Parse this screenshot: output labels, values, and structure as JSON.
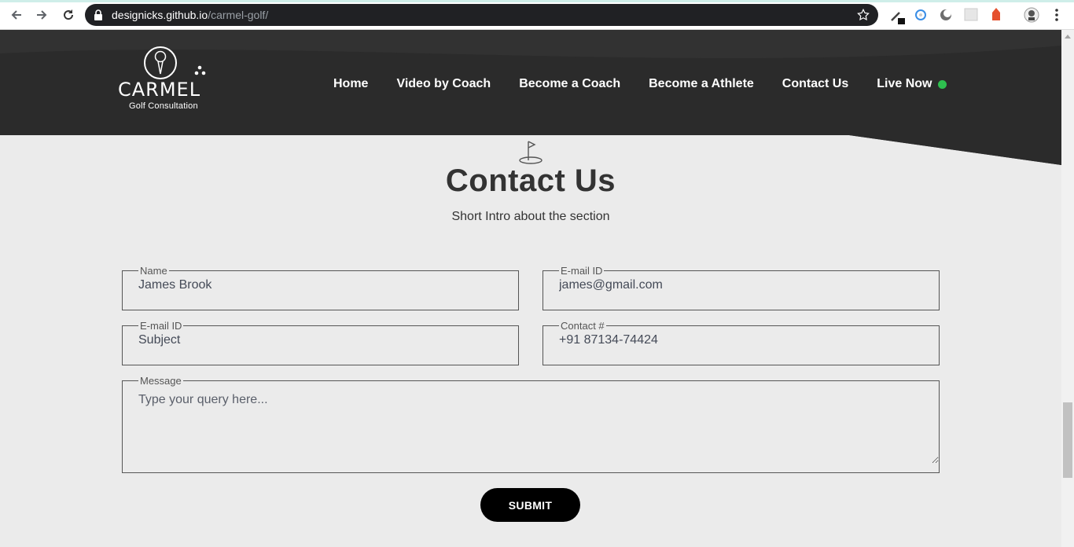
{
  "browser": {
    "url_host": "designicks.github.io",
    "url_path": "/carmel-golf/",
    "icons": [
      "back-arrow-icon",
      "forward-arrow-icon",
      "reload-icon",
      "lock-icon",
      "bookmark-star-icon",
      "eyedropper-extension-icon",
      "extension-icon",
      "extension-icon",
      "extension-icon",
      "extension-icon",
      "profile-avatar-icon",
      "more-menu-icon"
    ]
  },
  "brand": {
    "name": "CARMEL",
    "tagline": "Golf Consultation"
  },
  "nav": {
    "items": [
      {
        "label": "Home"
      },
      {
        "label": "Video by Coach"
      },
      {
        "label": "Become a Coach"
      },
      {
        "label": "Become a Athlete"
      },
      {
        "label": "Contact Us"
      },
      {
        "label": "Live Now"
      }
    ],
    "live_color": "#2ebf4f"
  },
  "section": {
    "title": "Contact Us",
    "intro": "Short Intro about the section"
  },
  "form": {
    "name": {
      "legend": "Name",
      "value": "James Brook"
    },
    "email": {
      "legend": "E-mail ID",
      "value": "james@gmail.com"
    },
    "subject": {
      "legend": "E-mail ID",
      "value": "Subject"
    },
    "contact": {
      "legend": "Contact #",
      "value": "+91 87134-74424"
    },
    "message": {
      "legend": "Message",
      "placeholder": "Type your query here..."
    },
    "submit_label": "SUBMIT"
  },
  "colors": {
    "header_bg": "#2a2a2a",
    "page_bg": "#ebebeb",
    "button_bg": "#000000"
  }
}
